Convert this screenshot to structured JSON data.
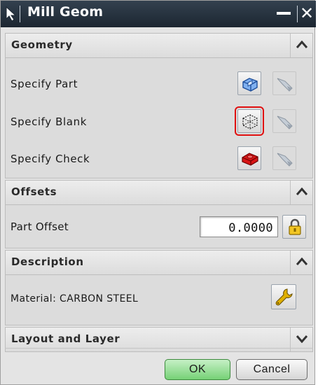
{
  "window": {
    "title": "Mill Geom",
    "close_glyph": "✕"
  },
  "geometry": {
    "header": "Geometry",
    "toggle_icon": "collapse-up-icon",
    "rows": [
      {
        "label": "Specify Part",
        "select_icon": "part-geometry-icon",
        "display_icon": "flashlight-display-icon"
      },
      {
        "label": "Specify Blank",
        "select_icon": "blank-geometry-icon",
        "display_icon": "flashlight-display-icon"
      },
      {
        "label": "Specify Check",
        "select_icon": "check-geometry-icon",
        "display_icon": "flashlight-display-icon"
      }
    ]
  },
  "offsets": {
    "header": "Offsets",
    "toggle_icon": "collapse-up-icon",
    "part_offset_label": "Part Offset",
    "part_offset_value": "0.0000",
    "lock_icon": "lock-icon"
  },
  "description": {
    "header": "Description",
    "toggle_icon": "collapse-up-icon",
    "material_label": "Material: CARBON STEEL",
    "material_icon": "wrench-icon"
  },
  "layout_layer": {
    "header": "Layout and Layer",
    "toggle_icon": "expand-down-icon"
  },
  "footer": {
    "ok_label": "OK",
    "cancel_label": "Cancel"
  },
  "colors": {
    "title_bar": "#1c2631",
    "ok_button": "#76d176",
    "highlight_box": "#e01010",
    "check_geometry": "#d81414",
    "part_geometry": "#5b8fd6"
  }
}
